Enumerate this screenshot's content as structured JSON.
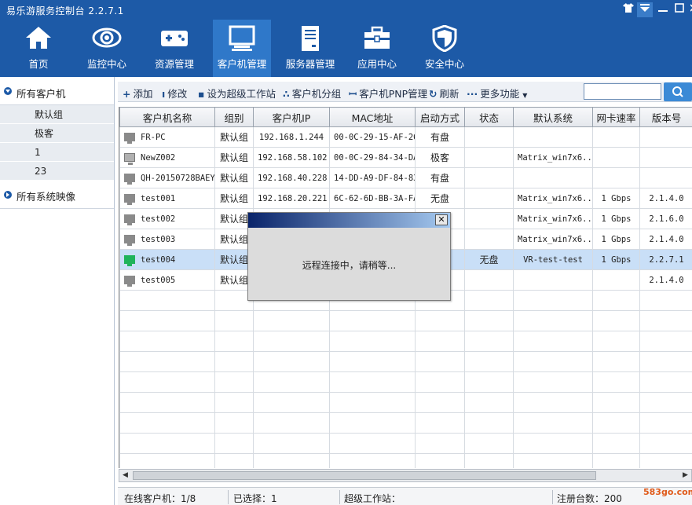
{
  "window": {
    "title": "易乐游服务控制台 2.2.7.1",
    "controls": [
      "shirt-icon",
      "dropdown-icon",
      "minimize-icon",
      "maximize-icon",
      "close-icon"
    ]
  },
  "nav": {
    "items": [
      {
        "label": "首页",
        "icon": "home-icon"
      },
      {
        "label": "监控中心",
        "icon": "eye-icon"
      },
      {
        "label": "资源管理",
        "icon": "gamepad-icon"
      },
      {
        "label": "客户机管理",
        "icon": "monitor-icon",
        "active": true
      },
      {
        "label": "服务器管理",
        "icon": "server-icon"
      },
      {
        "label": "应用中心",
        "icon": "toolbox-icon"
      },
      {
        "label": "安全中心",
        "icon": "shield-icon"
      }
    ]
  },
  "sidebar": {
    "all_clients": "所有客户机",
    "groups": [
      "默认组",
      "极客",
      "1",
      "23"
    ],
    "all_images": "所有系统映像"
  },
  "toolbar": {
    "add": "添加",
    "edit": "修改",
    "set_super": "设为超级工作站",
    "group": "客户机分组",
    "pnp": "客户机PNP管理",
    "refresh": "刷新",
    "more": "更多功能",
    "search_value": ""
  },
  "table": {
    "columns": [
      "客户机名称",
      "组别",
      "客户机IP",
      "MAC地址",
      "启动方式",
      "状态",
      "默认系统",
      "网卡速率",
      "版本号"
    ],
    "rows": [
      [
        "FR-PC",
        "默认组",
        "192.168.1.244",
        "00-0C-29-15-AF-26",
        "有盘",
        "",
        "",
        "",
        ""
      ],
      [
        "NewZ002",
        "默认组",
        "192.168.58.102",
        "00-0C-29-84-34-DA",
        "极客",
        "",
        "Matrix_win7x6...",
        "",
        ""
      ],
      [
        "QH-20150728BAEY",
        "默认组",
        "192.168.40.228",
        "14-DD-A9-DF-84-83",
        "有盘",
        "",
        "",
        "",
        ""
      ],
      [
        "test001",
        "默认组",
        "192.168.20.221",
        "6C-62-6D-BB-3A-FA",
        "无盘",
        "",
        "Matrix_win7x6...",
        "1 Gbps",
        "2.1.4.0"
      ],
      [
        "test002",
        "默认组",
        "",
        "",
        "",
        "",
        "Matrix_win7x6...",
        "1 Gbps",
        "2.1.6.0"
      ],
      [
        "test003",
        "默认组",
        "",
        "",
        "",
        "",
        "Matrix_win7x6...",
        "1 Gbps",
        "2.1.4.0"
      ],
      [
        "test004",
        "默认组",
        "",
        "",
        "",
        "无盘",
        "VR-test-test",
        "1 Gbps",
        "2.2.7.1"
      ],
      [
        "test005",
        "默认组",
        "",
        "",
        "",
        "",
        "",
        "",
        "2.1.4.0"
      ]
    ]
  },
  "status": {
    "online": "在线客户机：1/8",
    "selected": "已选择：1",
    "super": "超级工作站：",
    "registered": "注册台数：200"
  },
  "dialog": {
    "message": "远程连接中，请稍等..."
  },
  "watermark": "583go.com"
}
